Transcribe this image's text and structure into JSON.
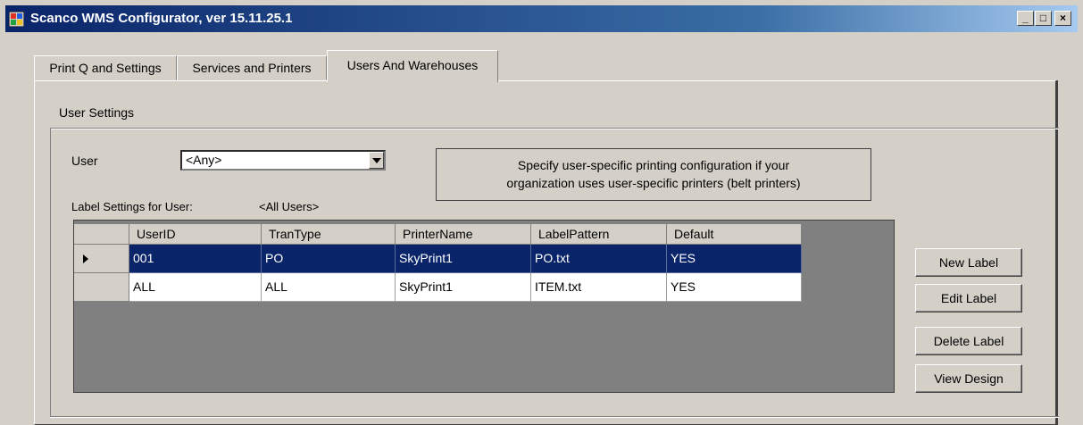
{
  "window": {
    "title": "Scanco WMS Configurator,  ver 15.11.25.1",
    "caption_buttons": {
      "minimize": "_",
      "maximize": "□",
      "close": "×"
    }
  },
  "tabs": [
    {
      "label": "Print Q and Settings",
      "active": false
    },
    {
      "label": "Services and Printers",
      "active": false
    },
    {
      "label": "Users And Warehouses",
      "active": true
    }
  ],
  "user_settings": {
    "group_title": "User Settings",
    "user_label": "User",
    "user_combo_value": "<Any>",
    "info_line1": "Specify user-specific printing configuration if your",
    "info_line2": "organization uses user-specific printers (belt printers)",
    "label_settings_caption": "Label Settings for User:",
    "label_settings_user": "<All Users>"
  },
  "grid": {
    "columns": [
      "UserID",
      "TranType",
      "PrinterName",
      "LabelPattern",
      "Default"
    ],
    "rows": [
      {
        "selected": true,
        "cells": [
          "001",
          "PO",
          "SkyPrint1",
          "PO.txt",
          "YES"
        ]
      },
      {
        "selected": false,
        "cells": [
          "ALL",
          "ALL",
          "SkyPrint1",
          "ITEM.txt",
          "YES"
        ]
      }
    ]
  },
  "buttons": {
    "new_label": "New Label",
    "edit_label": "Edit Label",
    "delete_label": "Delete Label",
    "view_design": "View Design"
  },
  "colors": {
    "title_bar": "#0a246a",
    "selection": "#0a246a",
    "grid_background": "#808080",
    "face": "#d4d0c8"
  }
}
